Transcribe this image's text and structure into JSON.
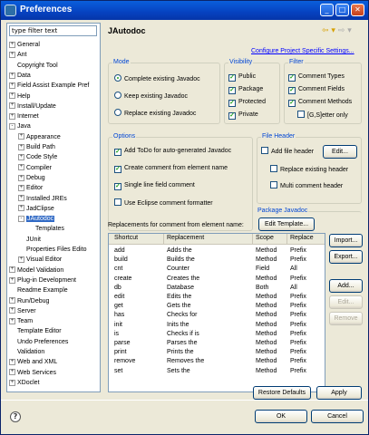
{
  "window": {
    "title": "Preferences",
    "minimize": "_",
    "maximize": "□",
    "close": "✕"
  },
  "filter": {
    "placeholder": "type filter text"
  },
  "tree": [
    {
      "label": "General",
      "depth": 0,
      "exp": "+"
    },
    {
      "label": "Ant",
      "depth": 0,
      "exp": "+"
    },
    {
      "label": "Copyright Tool",
      "depth": 0,
      "exp": ""
    },
    {
      "label": "Data",
      "depth": 0,
      "exp": "+"
    },
    {
      "label": "Field Assist Example Pref",
      "depth": 0,
      "exp": "+"
    },
    {
      "label": "Help",
      "depth": 0,
      "exp": "+"
    },
    {
      "label": "Install/Update",
      "depth": 0,
      "exp": "+"
    },
    {
      "label": "Internet",
      "depth": 0,
      "exp": "+"
    },
    {
      "label": "Java",
      "depth": 0,
      "exp": "-"
    },
    {
      "label": "Appearance",
      "depth": 1,
      "exp": "+"
    },
    {
      "label": "Build Path",
      "depth": 1,
      "exp": "+"
    },
    {
      "label": "Code Style",
      "depth": 1,
      "exp": "+"
    },
    {
      "label": "Compiler",
      "depth": 1,
      "exp": "+"
    },
    {
      "label": "Debug",
      "depth": 1,
      "exp": "+"
    },
    {
      "label": "Editor",
      "depth": 1,
      "exp": "+"
    },
    {
      "label": "Installed JREs",
      "depth": 1,
      "exp": "+"
    },
    {
      "label": "JadClipse",
      "depth": 1,
      "exp": "+"
    },
    {
      "label": "JAutodoc",
      "depth": 1,
      "exp": "-",
      "selected": true
    },
    {
      "label": "Templates",
      "depth": 2,
      "exp": ""
    },
    {
      "label": "JUnit",
      "depth": 1,
      "exp": ""
    },
    {
      "label": "Properties Files Edito",
      "depth": 1,
      "exp": ""
    },
    {
      "label": "Visual Editor",
      "depth": 1,
      "exp": "+"
    },
    {
      "label": "Model Validation",
      "depth": 0,
      "exp": "+"
    },
    {
      "label": "Plug-in Development",
      "depth": 0,
      "exp": "+"
    },
    {
      "label": "Readme Example",
      "depth": 0,
      "exp": ""
    },
    {
      "label": "Run/Debug",
      "depth": 0,
      "exp": "+"
    },
    {
      "label": "Server",
      "depth": 0,
      "exp": "+"
    },
    {
      "label": "Team",
      "depth": 0,
      "exp": "+"
    },
    {
      "label": "Template Editor",
      "depth": 0,
      "exp": ""
    },
    {
      "label": "Undo Preferences",
      "depth": 0,
      "exp": ""
    },
    {
      "label": "Validation",
      "depth": 0,
      "exp": ""
    },
    {
      "label": "Web and XML",
      "depth": 0,
      "exp": "+"
    },
    {
      "label": "Web Services",
      "depth": 0,
      "exp": "+"
    },
    {
      "label": "XDoclet",
      "depth": 0,
      "exp": "+"
    }
  ],
  "page": {
    "title": "JAutodoc",
    "nav_back": "⇦ ▾",
    "nav_fwd": "⇨ ▾",
    "config_link": "Configure Project Specific Settings..."
  },
  "mode": {
    "label": "Mode",
    "options": [
      "Complete existing Javadoc",
      "Keep existing Javadoc",
      "Replace existing Javadoc"
    ],
    "selected": 0
  },
  "visibility": {
    "label": "Visibility",
    "items": [
      "Public",
      "Package",
      "Protected",
      "Private"
    ]
  },
  "filter_group": {
    "label": "Filter",
    "items": [
      "Comment Types",
      "Comment Fields",
      "Comment Methods"
    ],
    "getter": "[G,S]etter only"
  },
  "options": {
    "label": "Options",
    "items": [
      {
        "text": "Add ToDo for auto-generated Javadoc",
        "checked": true
      },
      {
        "text": "Create comment from element name",
        "checked": true
      },
      {
        "text": "Single line field comment",
        "checked": true
      },
      {
        "text": "Use Eclipse comment formatter",
        "checked": false
      }
    ]
  },
  "file_header": {
    "label": "File Header",
    "add": "Add file header",
    "edit": "Edit...",
    "replace": "Replace existing header",
    "multi": "Multi comment header"
  },
  "package_javadoc": {
    "label": "Package Javadoc",
    "edit_template": "Edit Template..."
  },
  "replacements": {
    "label": "Replacements for comment from element name:",
    "headers": [
      "Shortcut",
      "Replacement",
      "Scope",
      "Replace"
    ],
    "rows": [
      [
        "add",
        "Adds the",
        "Method",
        "Prefix"
      ],
      [
        "build",
        "Builds the",
        "Method",
        "Prefix"
      ],
      [
        "cnt",
        "Counter",
        "Field",
        "All"
      ],
      [
        "create",
        "Creates the",
        "Method",
        "Prefix"
      ],
      [
        "db",
        "Database",
        "Both",
        "All"
      ],
      [
        "edit",
        "Edits the",
        "Method",
        "Prefix"
      ],
      [
        "get",
        "Gets the",
        "Method",
        "Prefix"
      ],
      [
        "has",
        "Checks for",
        "Method",
        "Prefix"
      ],
      [
        "init",
        "Inits the",
        "Method",
        "Prefix"
      ],
      [
        "is",
        "Checks if is",
        "Method",
        "Prefix"
      ],
      [
        "parse",
        "Parses the",
        "Method",
        "Prefix"
      ],
      [
        "print",
        "Prints the",
        "Method",
        "Prefix"
      ],
      [
        "remove",
        "Removes the",
        "Method",
        "Prefix"
      ],
      [
        "set",
        "Sets the",
        "Method",
        "Prefix"
      ]
    ],
    "buttons": {
      "import": "Import...",
      "export": "Export...",
      "add": "Add...",
      "edit": "Edit...",
      "remove": "Remove"
    }
  },
  "actions": {
    "restore": "Restore Defaults",
    "apply": "Apply"
  },
  "dialog": {
    "help": "?",
    "ok": "OK",
    "cancel": "Cancel"
  }
}
